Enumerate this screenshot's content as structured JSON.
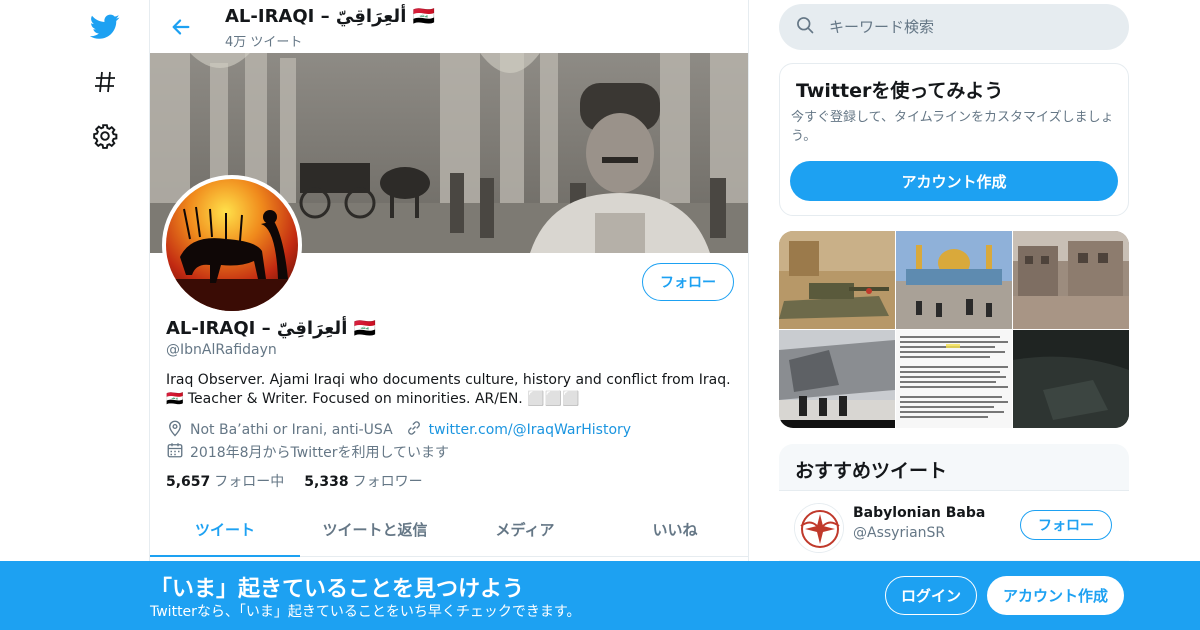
{
  "nav": {
    "icons": [
      "twitter-bird-icon",
      "hashtag-icon",
      "gear-icon"
    ]
  },
  "header": {
    "name": "AL-IRAQI – ألعِرَاقِيّ 🇮🇶",
    "tweet_count": "4万 ツイート"
  },
  "profile": {
    "name": "AL-IRAQI – ألعِرَاقِيّ 🇮🇶",
    "handle": "@IbnAlRafidayn",
    "bio": "Iraq Observer.  Ajami Iraqi who documents culture, history and conflict from Iraq.🇮🇶 Teacher & Writer. Focused on minorities. AR/EN. ⬜⬜⬜",
    "location": "Not Ba’athi or Irani, anti-USA",
    "link": "twitter.com/@IraqWarHistory",
    "joined": "2018年8月からTwitterを利用しています",
    "follow_label": "フォロー",
    "following_count": "5,657",
    "following_label": "フォロー中",
    "followers_count": "5,338",
    "followers_label": "フォロワー"
  },
  "tabs": [
    "ツイート",
    "ツイートと返信",
    "メディア",
    "いいね"
  ],
  "search": {
    "placeholder": "キーワード検索"
  },
  "signup_card": {
    "title": "Twitterを使ってみよう",
    "text": "今すぐ登録して、タイムラインをカスタマイズしましょう。",
    "button": "アカウント作成"
  },
  "media_grid": {
    "cells": [
      "tank-photo",
      "shrine-photo",
      "ruins-photo",
      "destroyed-building-photo",
      "document-photo",
      "dark-video-photo"
    ]
  },
  "recommend": {
    "title": "おすすめツイート",
    "user_name": "Babylonian Baba",
    "user_handle": "@AssyrianSR",
    "follow_label": "フォロー"
  },
  "bottom_bar": {
    "title": "「いま」起きていることを見つけよう",
    "subtitle": "Twitterなら、「いま」起きていることをいち早くチェックできます。",
    "login": "ログイン",
    "signup": "アカウント作成"
  },
  "colors": {
    "brand": "#1da1f2",
    "secondary_text": "#657786",
    "border": "#e6ecf0"
  }
}
